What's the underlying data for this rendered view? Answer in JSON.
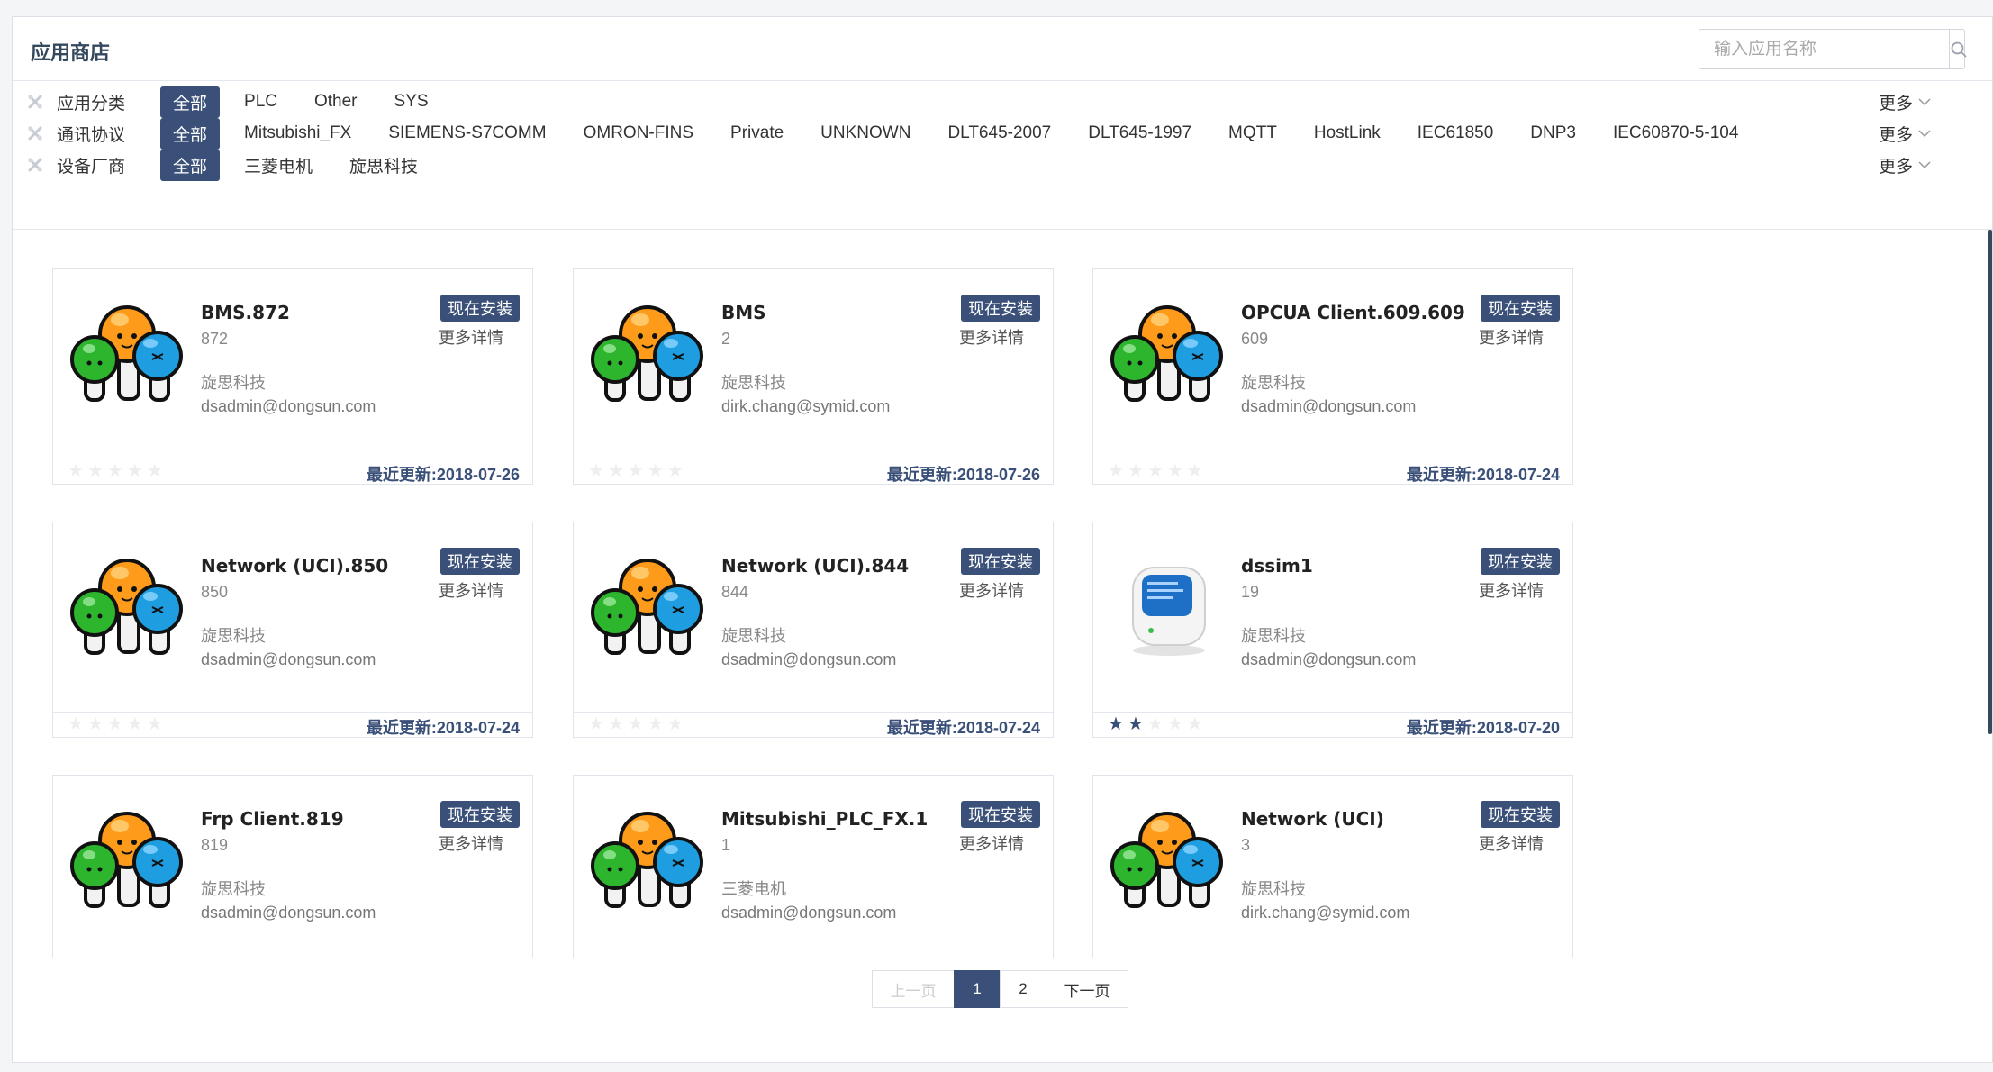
{
  "app": {
    "title": "应用商店"
  },
  "search": {
    "placeholder": "输入应用名称",
    "icon": "search-icon"
  },
  "filters": [
    {
      "label": "应用分类",
      "options": [
        "全部",
        "PLC",
        "Other",
        "SYS"
      ],
      "selected": "全部",
      "more": "更多"
    },
    {
      "label": "通讯协议",
      "options": [
        "全部",
        "Mitsubishi_FX",
        "SIEMENS-S7COMM",
        "OMRON-FINS",
        "Private",
        "UNKNOWN",
        "DLT645-2007",
        "DLT645-1997",
        "MQTT",
        "HostLink",
        "IEC61850",
        "DNP3",
        "IEC60870-5-104"
      ],
      "selected": "全部",
      "more": "更多"
    },
    {
      "label": "设备厂商",
      "options": [
        "全部",
        "三菱电机",
        "旋思科技"
      ],
      "selected": "全部",
      "more": "更多"
    }
  ],
  "cards": [
    {
      "name": "BMS.872",
      "version": "872",
      "vendor": "旋思科技",
      "email": "dsadmin@dongsun.com",
      "install": "现在安装",
      "detail": "更多详情",
      "rating": 0,
      "updated_label": "最近更新:",
      "updated": "2018-07-26",
      "icon": "mushroom-icon"
    },
    {
      "name": "BMS",
      "version": "2",
      "vendor": "旋思科技",
      "email": "dirk.chang@symid.com",
      "install": "现在安装",
      "detail": "更多详情",
      "rating": 0,
      "updated_label": "最近更新:",
      "updated": "2018-07-26",
      "icon": "mushroom-icon"
    },
    {
      "name": "OPCUA Client.609.609",
      "version": "609",
      "vendor": "旋思科技",
      "email": "dsadmin@dongsun.com",
      "install": "现在安装",
      "detail": "更多详情",
      "rating": 0,
      "updated_label": "最近更新:",
      "updated": "2018-07-24",
      "icon": "mushroom-icon"
    },
    {
      "name": "Network (UCI).850",
      "version": "850",
      "vendor": "旋思科技",
      "email": "dsadmin@dongsun.com",
      "install": "现在安装",
      "detail": "更多详情",
      "rating": 0,
      "updated_label": "最近更新:",
      "updated": "2018-07-24",
      "icon": "mushroom-icon"
    },
    {
      "name": "Network (UCI).844",
      "version": "844",
      "vendor": "旋思科技",
      "email": "dsadmin@dongsun.com",
      "install": "现在安装",
      "detail": "更多详情",
      "rating": 0,
      "updated_label": "最近更新:",
      "updated": "2018-07-24",
      "icon": "mushroom-icon"
    },
    {
      "name": "dssim1",
      "version": "19",
      "vendor": "旋思科技",
      "email": "dsadmin@dongsun.com",
      "install": "现在安装",
      "detail": "更多详情",
      "rating": 2,
      "updated_label": "最近更新:",
      "updated": "2018-07-20",
      "icon": "imac-icon"
    },
    {
      "name": "Frp Client.819",
      "version": "819",
      "vendor": "旋思科技",
      "email": "dsadmin@dongsun.com",
      "install": "现在安装",
      "detail": "更多详情",
      "icon": "mushroom-icon"
    },
    {
      "name": "Mitsubishi_PLC_FX.1",
      "version": "1",
      "vendor": "三菱电机",
      "email": "dsadmin@dongsun.com",
      "install": "现在安装",
      "detail": "更多详情",
      "icon": "mushroom-icon"
    },
    {
      "name": "Network (UCI)",
      "version": "3",
      "vendor": "旋思科技",
      "email": "dirk.chang@symid.com",
      "install": "现在安装",
      "detail": "更多详情",
      "icon": "mushroom-icon"
    }
  ],
  "pagination": {
    "prev": "上一页",
    "pages": [
      "1",
      "2"
    ],
    "current": "1",
    "next": "下一页"
  },
  "colors": {
    "accent": "#3a5078",
    "title": "#34495e"
  }
}
